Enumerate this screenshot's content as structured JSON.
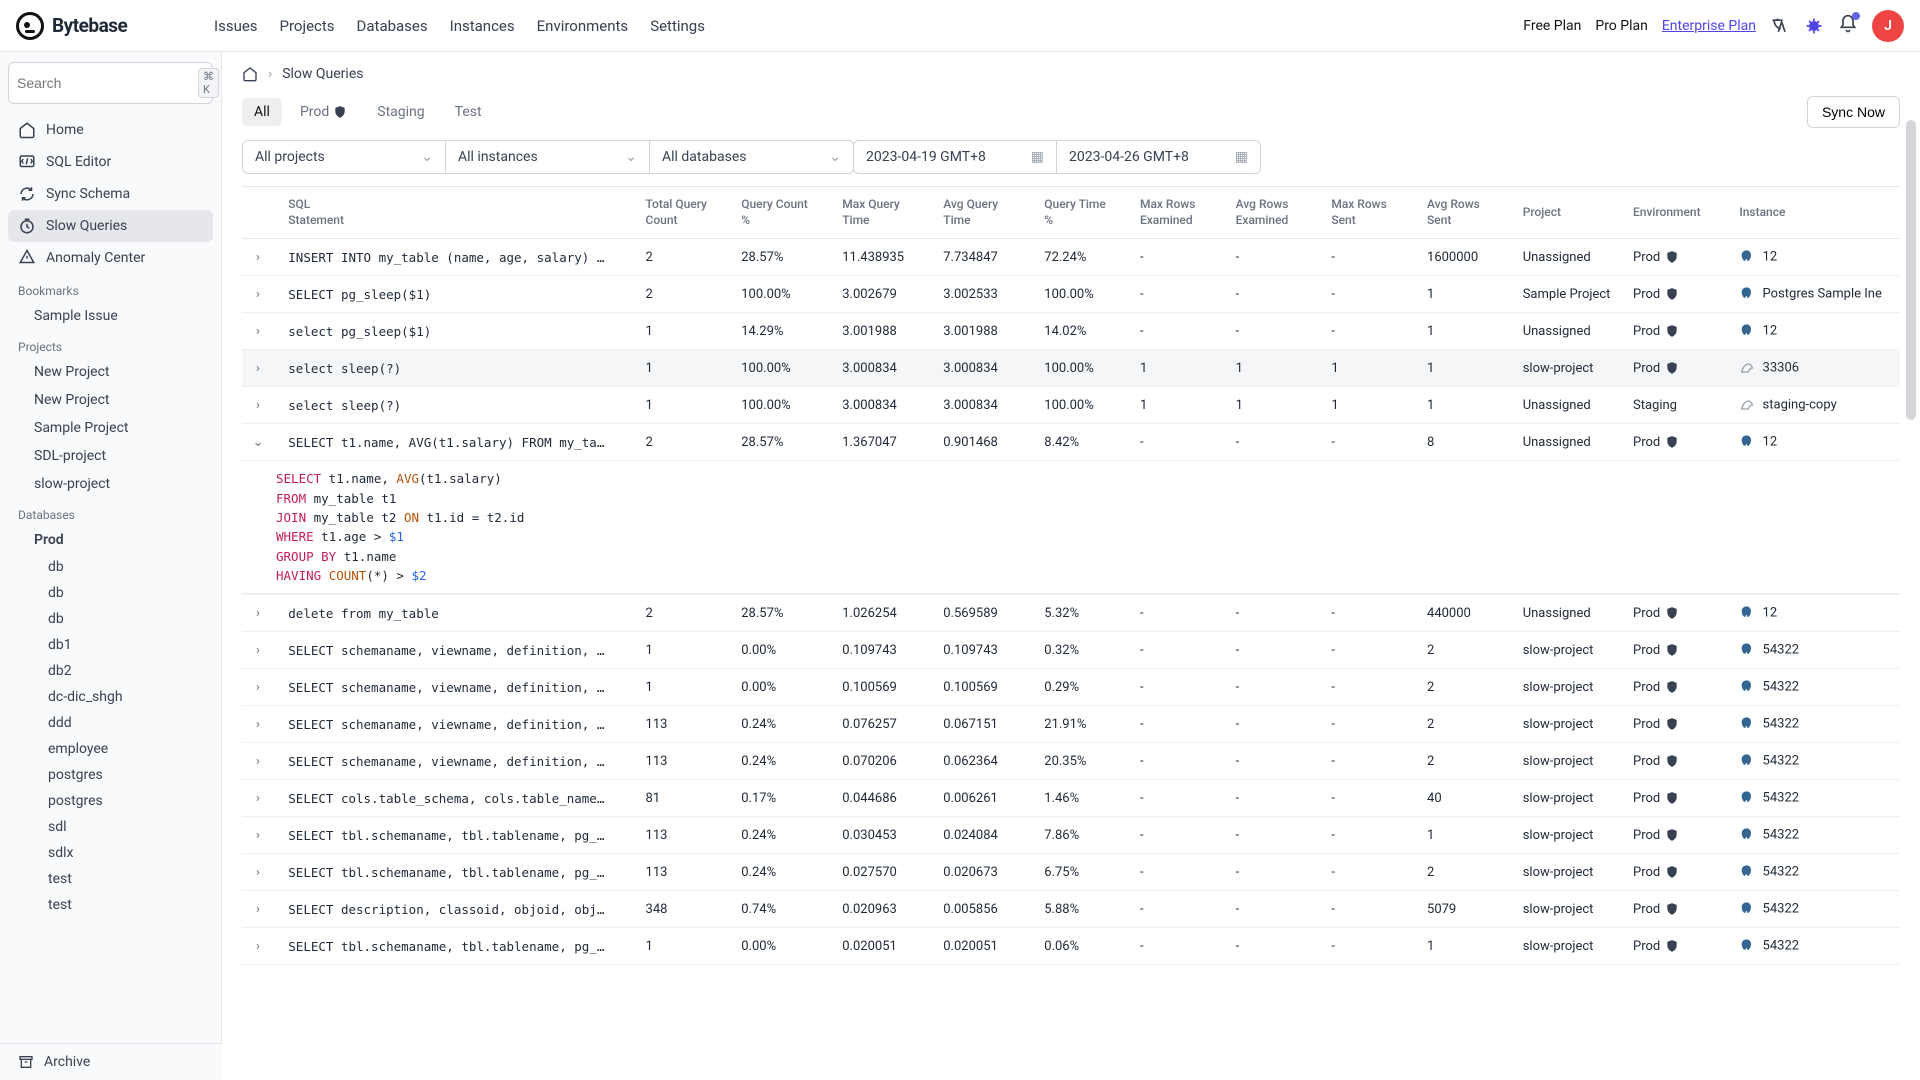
{
  "brand": "Bytebase",
  "topnav": [
    "Issues",
    "Projects",
    "Databases",
    "Instances",
    "Environments",
    "Settings"
  ],
  "plans": {
    "free": "Free Plan",
    "pro": "Pro Plan",
    "ent": "Enterprise Plan"
  },
  "avatar_initial": "J",
  "search_placeholder": "Search",
  "search_kbd": "⌘ K",
  "side_primary": [
    {
      "icon": "home",
      "label": "Home"
    },
    {
      "icon": "sql",
      "label": "SQL Editor"
    },
    {
      "icon": "sync",
      "label": "Sync Schema"
    },
    {
      "icon": "slow",
      "label": "Slow Queries",
      "active": true
    },
    {
      "icon": "anom",
      "label": "Anomaly Center"
    }
  ],
  "bookmarks_header": "Bookmarks",
  "bookmarks": [
    "Sample Issue"
  ],
  "projects_header": "Projects",
  "projects": [
    "New Project",
    "New Project",
    "Sample Project",
    "SDL-project",
    "slow-project"
  ],
  "databases_header": "Databases",
  "db_env": "Prod",
  "databases": [
    "db",
    "db",
    "db",
    "db1",
    "db2",
    "dc-dic_shgh",
    "ddd",
    "employee",
    "postgres",
    "postgres",
    "sdl",
    "sdlx",
    "test",
    "test"
  ],
  "archive": "Archive",
  "breadcrumb": {
    "page": "Slow Queries"
  },
  "tabs": [
    {
      "label": "All",
      "active": true
    },
    {
      "label": "Prod",
      "shield": true
    },
    {
      "label": "Staging"
    },
    {
      "label": "Test"
    }
  ],
  "sync_btn": "Sync Now",
  "filters": {
    "project": "All projects",
    "instance": "All instances",
    "database": "All databases",
    "date_from": "2023-04-19 GMT+8",
    "date_to": "2023-04-26 GMT+8"
  },
  "columns": [
    "",
    "SQL Statement",
    "Total Query Count",
    "Query Count %",
    "Max Query Time",
    "Avg Query Time",
    "Query Time %",
    "Max Rows Examined",
    "Avg Rows Examined",
    "Max Rows Sent",
    "Avg Rows Sent",
    "Project",
    "Environment",
    "Instance"
  ],
  "rows": [
    {
      "sql": "INSERT INTO my_table (name, age, salary) S…",
      "count": "2",
      "cpct": "28.57%",
      "maxt": "11.438935",
      "avgt": "7.734847",
      "qtpct": "72.24%",
      "mre": "-",
      "are": "-",
      "mrs": "-",
      "ars": "1600000",
      "proj": "Unassigned",
      "env": "Prod",
      "env_shield": true,
      "inst": "12",
      "inst_type": "pg"
    },
    {
      "sql": "SELECT pg_sleep($1)",
      "count": "2",
      "cpct": "100.00%",
      "maxt": "3.002679",
      "avgt": "3.002533",
      "qtpct": "100.00%",
      "mre": "-",
      "are": "-",
      "mrs": "-",
      "ars": "1",
      "proj": "Sample Project",
      "env": "Prod",
      "env_shield": true,
      "inst": "Postgres Sample Ine",
      "inst_type": "pg"
    },
    {
      "sql": "select pg_sleep($1)",
      "count": "1",
      "cpct": "14.29%",
      "maxt": "3.001988",
      "avgt": "3.001988",
      "qtpct": "14.02%",
      "mre": "-",
      "are": "-",
      "mrs": "-",
      "ars": "1",
      "proj": "Unassigned",
      "env": "Prod",
      "env_shield": true,
      "inst": "12",
      "inst_type": "pg"
    },
    {
      "sql": "select sleep(?)",
      "count": "1",
      "cpct": "100.00%",
      "maxt": "3.000834",
      "avgt": "3.000834",
      "qtpct": "100.00%",
      "mre": "1",
      "are": "1",
      "mrs": "1",
      "ars": "1",
      "proj": "slow-project",
      "env": "Prod",
      "env_shield": true,
      "inst": "33306",
      "inst_type": "my",
      "sel": true
    },
    {
      "sql": "select sleep(?)",
      "count": "1",
      "cpct": "100.00%",
      "maxt": "3.000834",
      "avgt": "3.000834",
      "qtpct": "100.00%",
      "mre": "1",
      "are": "1",
      "mrs": "1",
      "ars": "1",
      "proj": "Unassigned",
      "env": "Staging",
      "env_shield": false,
      "inst": "staging-copy",
      "inst_type": "my"
    },
    {
      "sql": "SELECT t1.name, AVG(t1.salary) FROM my_tab…",
      "count": "2",
      "cpct": "28.57%",
      "maxt": "1.367047",
      "avgt": "0.901468",
      "qtpct": "8.42%",
      "mre": "-",
      "are": "-",
      "mrs": "-",
      "ars": "8",
      "proj": "Unassigned",
      "env": "Prod",
      "env_shield": true,
      "inst": "12",
      "inst_type": "pg",
      "expanded": true
    },
    {
      "sql": "delete from my_table",
      "count": "2",
      "cpct": "28.57%",
      "maxt": "1.026254",
      "avgt": "0.569589",
      "qtpct": "5.32%",
      "mre": "-",
      "are": "-",
      "mrs": "-",
      "ars": "440000",
      "proj": "Unassigned",
      "env": "Prod",
      "env_shield": true,
      "inst": "12",
      "inst_type": "pg"
    },
    {
      "sql": "SELECT schemaname, viewname, definition, o…",
      "count": "1",
      "cpct": "0.00%",
      "maxt": "0.109743",
      "avgt": "0.109743",
      "qtpct": "0.32%",
      "mre": "-",
      "are": "-",
      "mrs": "-",
      "ars": "2",
      "proj": "slow-project",
      "env": "Prod",
      "env_shield": true,
      "inst": "54322",
      "inst_type": "pg"
    },
    {
      "sql": "SELECT schemaname, viewname, definition, o…",
      "count": "1",
      "cpct": "0.00%",
      "maxt": "0.100569",
      "avgt": "0.100569",
      "qtpct": "0.29%",
      "mre": "-",
      "are": "-",
      "mrs": "-",
      "ars": "2",
      "proj": "slow-project",
      "env": "Prod",
      "env_shield": true,
      "inst": "54322",
      "inst_type": "pg"
    },
    {
      "sql": "SELECT schemaname, viewname, definition, o…",
      "count": "113",
      "cpct": "0.24%",
      "maxt": "0.076257",
      "avgt": "0.067151",
      "qtpct": "21.91%",
      "mre": "-",
      "are": "-",
      "mrs": "-",
      "ars": "2",
      "proj": "slow-project",
      "env": "Prod",
      "env_shield": true,
      "inst": "54322",
      "inst_type": "pg"
    },
    {
      "sql": "SELECT schemaname, viewname, definition, o…",
      "count": "113",
      "cpct": "0.24%",
      "maxt": "0.070206",
      "avgt": "0.062364",
      "qtpct": "20.35%",
      "mre": "-",
      "are": "-",
      "mrs": "-",
      "ars": "2",
      "proj": "slow-project",
      "env": "Prod",
      "env_shield": true,
      "inst": "54322",
      "inst_type": "pg"
    },
    {
      "sql": "SELECT cols.table_schema, cols.table_name,…",
      "count": "81",
      "cpct": "0.17%",
      "maxt": "0.044686",
      "avgt": "0.006261",
      "qtpct": "1.46%",
      "mre": "-",
      "are": "-",
      "mrs": "-",
      "ars": "40",
      "proj": "slow-project",
      "env": "Prod",
      "env_shield": true,
      "inst": "54322",
      "inst_type": "pg"
    },
    {
      "sql": "SELECT tbl.schemaname, tbl.tablename, pg_t…",
      "count": "113",
      "cpct": "0.24%",
      "maxt": "0.030453",
      "avgt": "0.024084",
      "qtpct": "7.86%",
      "mre": "-",
      "are": "-",
      "mrs": "-",
      "ars": "1",
      "proj": "slow-project",
      "env": "Prod",
      "env_shield": true,
      "inst": "54322",
      "inst_type": "pg"
    },
    {
      "sql": "SELECT tbl.schemaname, tbl.tablename, pg_t…",
      "count": "113",
      "cpct": "0.24%",
      "maxt": "0.027570",
      "avgt": "0.020673",
      "qtpct": "6.75%",
      "mre": "-",
      "are": "-",
      "mrs": "-",
      "ars": "2",
      "proj": "slow-project",
      "env": "Prod",
      "env_shield": true,
      "inst": "54322",
      "inst_type": "pg"
    },
    {
      "sql": "SELECT description, classoid, objoid, objs…",
      "count": "348",
      "cpct": "0.74%",
      "maxt": "0.020963",
      "avgt": "0.005856",
      "qtpct": "5.88%",
      "mre": "-",
      "are": "-",
      "mrs": "-",
      "ars": "5079",
      "proj": "slow-project",
      "env": "Prod",
      "env_shield": true,
      "inst": "54322",
      "inst_type": "pg"
    },
    {
      "sql": "SELECT tbl.schemaname, tbl.tablename, pg_t…",
      "count": "1",
      "cpct": "0.00%",
      "maxt": "0.020051",
      "avgt": "0.020051",
      "qtpct": "0.06%",
      "mre": "-",
      "are": "-",
      "mrs": "-",
      "ars": "1",
      "proj": "slow-project",
      "env": "Prod",
      "env_shield": true,
      "inst": "54322",
      "inst_type": "pg"
    }
  ],
  "expanded_sql_html": "<span class='kw'>SELECT</span> t1.name, <span class='fn'>AVG</span>(t1.salary)\n<span class='kw'>FROM</span> my_table t1\n<span class='kw'>JOIN</span> my_table t2 <span class='op'>ON</span> t1.id = t2.id\n<span class='kw'>WHERE</span> t1.age > <span class='num'>$1</span>\n<span class='kw'>GROUP BY</span> t1.name\n<span class='kw'>HAVING</span> <span class='fn'>COUNT</span>(*) > <span class='num'>$2</span>"
}
